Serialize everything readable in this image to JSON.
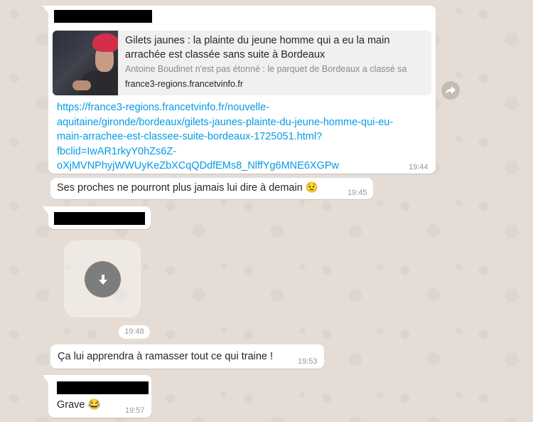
{
  "messages": [
    {
      "preview": {
        "title": "Gilets jaunes : la plainte du jeune homme qui a eu la main arrachée est classée sans suite à Bordeaux",
        "description": "Antoine Boudinet n'est pas étonné : le parquet de Bordeaux a classé sa",
        "domain": "france3-regions.francetvinfo.fr"
      },
      "link_lines": [
        "https://france3-regions.francetvinfo.fr/nouvelle-",
        "aquitaine/gironde/bordeaux/gilets-jaunes-plainte-du-jeune-homme-qui-eu-",
        "main-arrachee-est-classee-suite-bordeaux-1725051.html?",
        "fbclid=IwAR1rkyY0hZs6Z-",
        "oXjMVNPhyjWWUyKeZbXCqQDdfEMs8_NlffYg6MNE6XGPw"
      ],
      "time": "19:44"
    },
    {
      "text": "Ses proches ne pourront plus jamais lui dire à demain 😟",
      "time": "19:45"
    },
    {
      "time": "19:48"
    },
    {
      "text": "Ça lui apprendra à ramasser tout ce qui traine !",
      "time": "19:53"
    },
    {
      "text": "Grave 😂",
      "time": "19:57"
    }
  ],
  "icons": {
    "forward": "forward-icon",
    "download": "download-icon"
  },
  "colors": {
    "link": "#039be5",
    "bubble": "#ffffff",
    "background": "#e5ddd5"
  }
}
